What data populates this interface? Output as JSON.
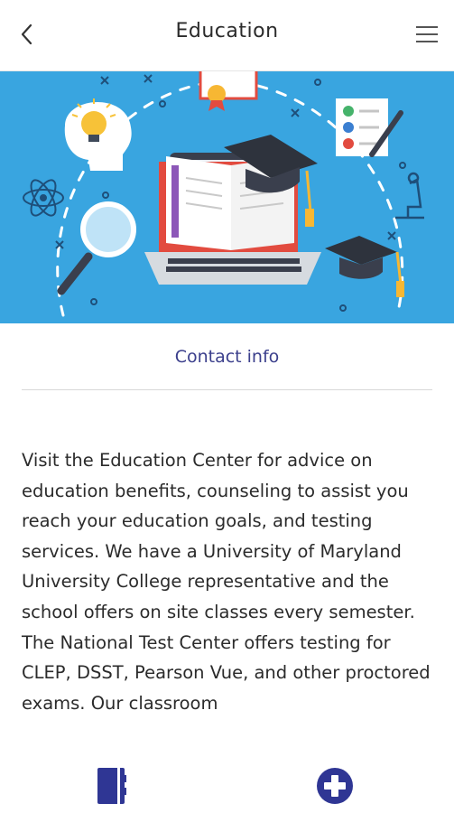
{
  "header": {
    "title": "Education",
    "back_icon": "chevron-left-icon",
    "menu_icon": "hamburger-menu-icon"
  },
  "hero": {
    "background_color": "#39a5e0"
  },
  "contact": {
    "label": "Contact info"
  },
  "content": {
    "description": "Visit the Education Center for advice on education benefits, counseling to assist you reach your education goals, and testing services. We have a University of Maryland University College representative and the school offers on site classes every semester. The National Test Center offers testing for CLEP, DSST, Pearson Vue, and other proctored exams. Our classroom"
  },
  "tabbar": {
    "left_icon": "directory-book-icon",
    "right_icon": "medical-cross-icon"
  },
  "colors": {
    "accent": "#3b3f8c",
    "icon_blue": "#2f3694",
    "text": "#2b2b2b"
  }
}
